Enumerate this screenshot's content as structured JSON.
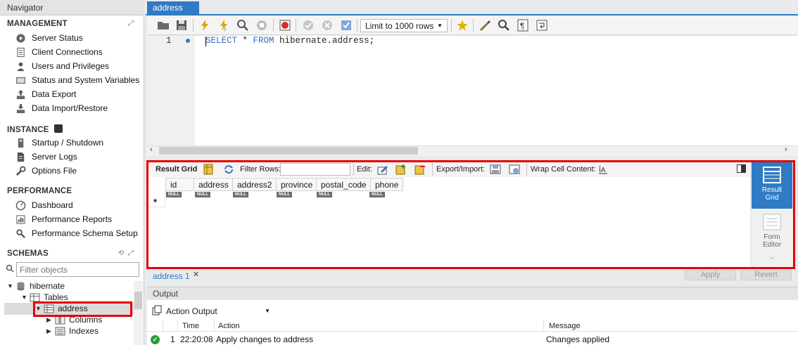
{
  "navigator": {
    "title": "Navigator",
    "management": {
      "title": "MANAGEMENT",
      "items": [
        {
          "label": "Server Status",
          "icon": "server-status-icon"
        },
        {
          "label": "Client Connections",
          "icon": "client-connections-icon"
        },
        {
          "label": "Users and Privileges",
          "icon": "users-icon"
        },
        {
          "label": "Status and System Variables",
          "icon": "system-variables-icon"
        },
        {
          "label": "Data Export",
          "icon": "data-export-icon"
        },
        {
          "label": "Data Import/Restore",
          "icon": "data-import-icon"
        }
      ]
    },
    "instance": {
      "title": "INSTANCE",
      "items": [
        {
          "label": "Startup / Shutdown",
          "icon": "startup-shutdown-icon"
        },
        {
          "label": "Server Logs",
          "icon": "server-logs-icon"
        },
        {
          "label": "Options File",
          "icon": "options-file-icon"
        }
      ]
    },
    "performance": {
      "title": "PERFORMANCE",
      "items": [
        {
          "label": "Dashboard",
          "icon": "dashboard-icon"
        },
        {
          "label": "Performance Reports",
          "icon": "performance-reports-icon"
        },
        {
          "label": "Performance Schema Setup",
          "icon": "schema-setup-icon"
        }
      ]
    },
    "schemas": {
      "title": "SCHEMAS",
      "filter_placeholder": "Filter objects",
      "tree": {
        "schema": "hibernate",
        "tables": "Tables",
        "table": "address",
        "columns": "Columns",
        "indexes": "Indexes"
      }
    }
  },
  "editor": {
    "tab_label": "address",
    "limit_label": "Limit to 1000 rows",
    "line_number": "1",
    "sql_kw1": "SELECT",
    "sql_mid": " * ",
    "sql_kw2": "FROM",
    "sql_rest": " hibernate.address;"
  },
  "result": {
    "toolbar": {
      "result_grid": "Result Grid",
      "filter_rows": "Filter Rows:",
      "edit": "Edit:",
      "export_import": "Export/Import:",
      "wrap": "Wrap Cell Content:"
    },
    "columns": [
      "id",
      "address",
      "address2",
      "province",
      "postal_code",
      "phone"
    ],
    "null_text": "NULL",
    "new_row_marker": "*",
    "side": {
      "result_grid_line1": "Result",
      "result_grid_line2": "Grid",
      "form_editor_line1": "Form",
      "form_editor_line2": "Editor"
    },
    "tab_label": "address 1",
    "apply": "Apply",
    "revert": "Revert"
  },
  "output": {
    "title": "Output",
    "selector": "Action Output",
    "headers": {
      "time": "Time",
      "action": "Action",
      "message": "Message"
    },
    "rows": [
      {
        "num": "1",
        "time": "22:20:08",
        "action": "Apply changes to address",
        "message": "Changes applied"
      }
    ]
  },
  "colors": {
    "accent": "#2f7bc5",
    "highlight": "#e60000",
    "success": "#2d9d3a"
  }
}
